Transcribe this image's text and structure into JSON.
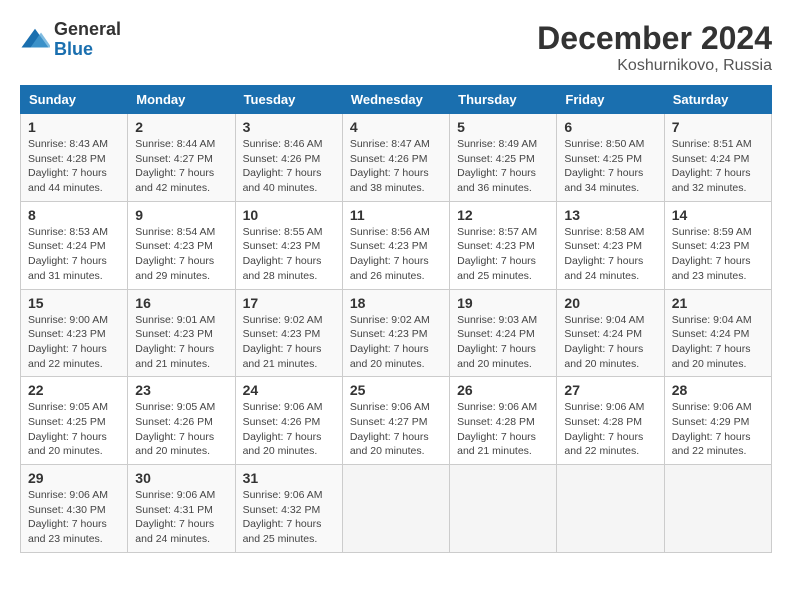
{
  "app": {
    "logo_general": "General",
    "logo_blue": "Blue"
  },
  "header": {
    "title": "December 2024",
    "subtitle": "Koshurnikovo, Russia"
  },
  "calendar": {
    "days_of_week": [
      "Sunday",
      "Monday",
      "Tuesday",
      "Wednesday",
      "Thursday",
      "Friday",
      "Saturday"
    ],
    "weeks": [
      [
        {
          "day": 1,
          "sunrise": "8:43 AM",
          "sunset": "4:28 PM",
          "daylight": "7 hours and 44 minutes."
        },
        {
          "day": 2,
          "sunrise": "8:44 AM",
          "sunset": "4:27 PM",
          "daylight": "7 hours and 42 minutes."
        },
        {
          "day": 3,
          "sunrise": "8:46 AM",
          "sunset": "4:26 PM",
          "daylight": "7 hours and 40 minutes."
        },
        {
          "day": 4,
          "sunrise": "8:47 AM",
          "sunset": "4:26 PM",
          "daylight": "7 hours and 38 minutes."
        },
        {
          "day": 5,
          "sunrise": "8:49 AM",
          "sunset": "4:25 PM",
          "daylight": "7 hours and 36 minutes."
        },
        {
          "day": 6,
          "sunrise": "8:50 AM",
          "sunset": "4:25 PM",
          "daylight": "7 hours and 34 minutes."
        },
        {
          "day": 7,
          "sunrise": "8:51 AM",
          "sunset": "4:24 PM",
          "daylight": "7 hours and 32 minutes."
        }
      ],
      [
        {
          "day": 8,
          "sunrise": "8:53 AM",
          "sunset": "4:24 PM",
          "daylight": "7 hours and 31 minutes."
        },
        {
          "day": 9,
          "sunrise": "8:54 AM",
          "sunset": "4:23 PM",
          "daylight": "7 hours and 29 minutes."
        },
        {
          "day": 10,
          "sunrise": "8:55 AM",
          "sunset": "4:23 PM",
          "daylight": "7 hours and 28 minutes."
        },
        {
          "day": 11,
          "sunrise": "8:56 AM",
          "sunset": "4:23 PM",
          "daylight": "7 hours and 26 minutes."
        },
        {
          "day": 12,
          "sunrise": "8:57 AM",
          "sunset": "4:23 PM",
          "daylight": "7 hours and 25 minutes."
        },
        {
          "day": 13,
          "sunrise": "8:58 AM",
          "sunset": "4:23 PM",
          "daylight": "7 hours and 24 minutes."
        },
        {
          "day": 14,
          "sunrise": "8:59 AM",
          "sunset": "4:23 PM",
          "daylight": "7 hours and 23 minutes."
        }
      ],
      [
        {
          "day": 15,
          "sunrise": "9:00 AM",
          "sunset": "4:23 PM",
          "daylight": "7 hours and 22 minutes."
        },
        {
          "day": 16,
          "sunrise": "9:01 AM",
          "sunset": "4:23 PM",
          "daylight": "7 hours and 21 minutes."
        },
        {
          "day": 17,
          "sunrise": "9:02 AM",
          "sunset": "4:23 PM",
          "daylight": "7 hours and 21 minutes."
        },
        {
          "day": 18,
          "sunrise": "9:02 AM",
          "sunset": "4:23 PM",
          "daylight": "7 hours and 20 minutes."
        },
        {
          "day": 19,
          "sunrise": "9:03 AM",
          "sunset": "4:24 PM",
          "daylight": "7 hours and 20 minutes."
        },
        {
          "day": 20,
          "sunrise": "9:04 AM",
          "sunset": "4:24 PM",
          "daylight": "7 hours and 20 minutes."
        },
        {
          "day": 21,
          "sunrise": "9:04 AM",
          "sunset": "4:24 PM",
          "daylight": "7 hours and 20 minutes."
        }
      ],
      [
        {
          "day": 22,
          "sunrise": "9:05 AM",
          "sunset": "4:25 PM",
          "daylight": "7 hours and 20 minutes."
        },
        {
          "day": 23,
          "sunrise": "9:05 AM",
          "sunset": "4:26 PM",
          "daylight": "7 hours and 20 minutes."
        },
        {
          "day": 24,
          "sunrise": "9:06 AM",
          "sunset": "4:26 PM",
          "daylight": "7 hours and 20 minutes."
        },
        {
          "day": 25,
          "sunrise": "9:06 AM",
          "sunset": "4:27 PM",
          "daylight": "7 hours and 20 minutes."
        },
        {
          "day": 26,
          "sunrise": "9:06 AM",
          "sunset": "4:28 PM",
          "daylight": "7 hours and 21 minutes."
        },
        {
          "day": 27,
          "sunrise": "9:06 AM",
          "sunset": "4:28 PM",
          "daylight": "7 hours and 22 minutes."
        },
        {
          "day": 28,
          "sunrise": "9:06 AM",
          "sunset": "4:29 PM",
          "daylight": "7 hours and 22 minutes."
        }
      ],
      [
        {
          "day": 29,
          "sunrise": "9:06 AM",
          "sunset": "4:30 PM",
          "daylight": "7 hours and 23 minutes."
        },
        {
          "day": 30,
          "sunrise": "9:06 AM",
          "sunset": "4:31 PM",
          "daylight": "7 hours and 24 minutes."
        },
        {
          "day": 31,
          "sunrise": "9:06 AM",
          "sunset": "4:32 PM",
          "daylight": "7 hours and 25 minutes."
        },
        null,
        null,
        null,
        null
      ]
    ]
  }
}
